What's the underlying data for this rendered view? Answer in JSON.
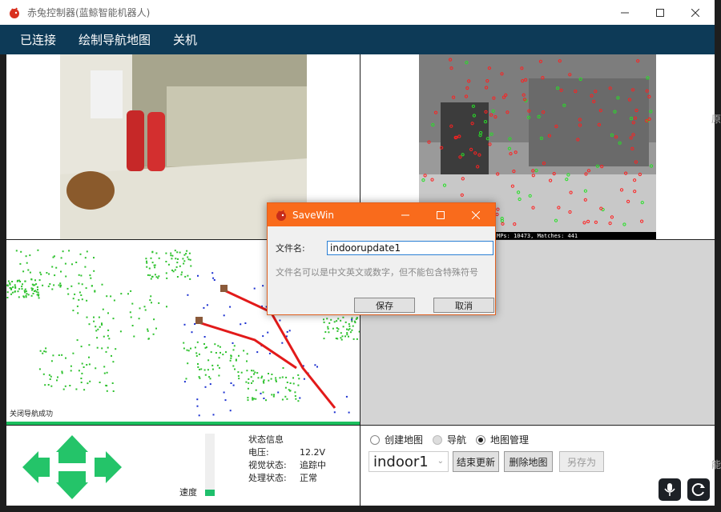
{
  "window": {
    "title": "赤兔控制器(蓝鲸智能机器人)",
    "minimize_icon": "minimize-icon",
    "maximize_icon": "maximize-icon",
    "close_icon": "close-icon"
  },
  "menu": [
    "已连接",
    "绘制导航地图",
    "关机"
  ],
  "camera_right": {
    "overlay_text": "MPs: 10473, Matches: 441"
  },
  "map": {
    "status_text": "关闭导航成功"
  },
  "speed": {
    "label": "速度",
    "level": 0.1
  },
  "status": {
    "heading": "状态信息",
    "rows": [
      {
        "key": "电压:",
        "value": "12.2V"
      },
      {
        "key": "视觉状态:",
        "value": "追踪中"
      },
      {
        "key": "处理状态:",
        "value": "正常"
      }
    ]
  },
  "modes": [
    {
      "label": "创建地图",
      "checked": false,
      "disabled": false
    },
    {
      "label": "导航",
      "checked": false,
      "disabled": true
    },
    {
      "label": "地图管理",
      "checked": true,
      "disabled": false
    }
  ],
  "map_select": {
    "value": "indoor1"
  },
  "buttons": {
    "end_update": "结束更新",
    "delete_map": "删除地图",
    "save_as": "另存为"
  },
  "dialog": {
    "title": "SaveWin",
    "label": "文件名:",
    "input_value": "indoorupdate1",
    "hint": "文件名可以是中文英文或数字，但不能包含特殊符号",
    "save": "保存",
    "cancel": "取消"
  },
  "colors": {
    "menubar": "#0d3a57",
    "accent_green": "#1fbf6c",
    "dialog_title": "#f96b1c"
  },
  "side_fragments": [
    "原",
    "能"
  ]
}
